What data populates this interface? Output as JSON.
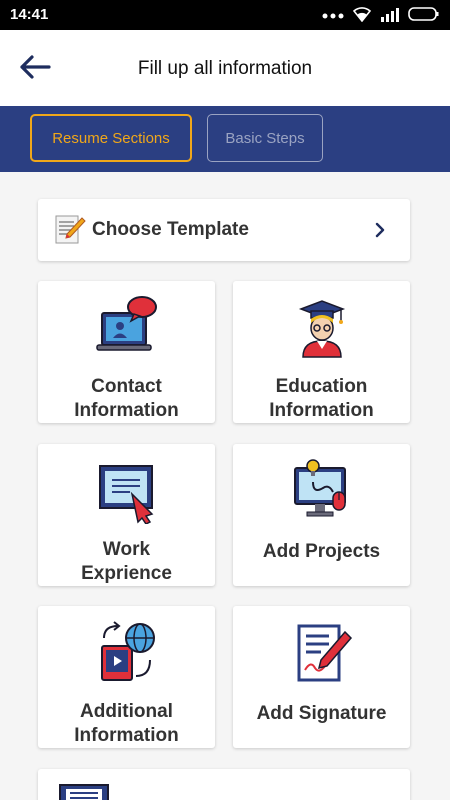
{
  "status": {
    "time": "14:41"
  },
  "header": {
    "title": "Fill up all information"
  },
  "tabs": [
    {
      "label": "Resume Sections",
      "active": true
    },
    {
      "label": "Basic Steps",
      "active": false
    }
  ],
  "choose_template": {
    "label": "Choose Template"
  },
  "sections": [
    {
      "label_line1": "Contact",
      "label_line2": "Information",
      "icon": "laptop-contact-icon"
    },
    {
      "label_line1": "Education",
      "label_line2": "Information",
      "icon": "graduate-icon"
    },
    {
      "label_line1": "Work",
      "label_line2": "Exprience",
      "icon": "certificate-icon"
    },
    {
      "label_line1": "Add Projects",
      "label_line2": "",
      "icon": "monitor-project-icon"
    },
    {
      "label_line1": "Additional",
      "label_line2": "Information",
      "icon": "globe-book-icon"
    },
    {
      "label_line1": "Add Signature",
      "label_line2": "",
      "icon": "signature-document-icon"
    }
  ],
  "colors": {
    "primary": "#2b3f82",
    "accent": "#f0a71a",
    "icon_red": "#e0303a"
  }
}
